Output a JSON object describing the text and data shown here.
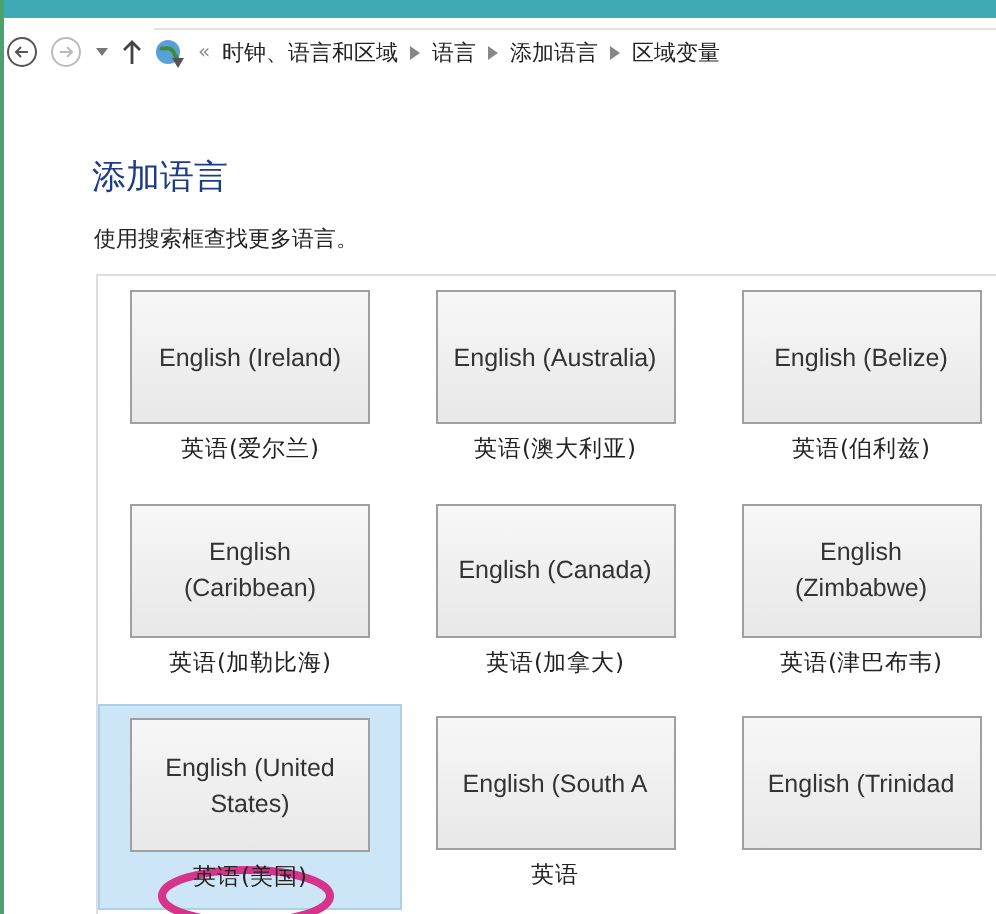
{
  "breadcrumb": {
    "overflow": "«",
    "items": [
      "时钟、语言和区域",
      "语言",
      "添加语言",
      "区域变量"
    ]
  },
  "heading": "添加语言",
  "hint": "使用搜索框查找更多语言。",
  "languages": [
    {
      "name": "English (Ireland)",
      "label": "英语(爱尔兰)",
      "selected": false,
      "circled": false
    },
    {
      "name": "English (Australia)",
      "label": "英语(澳大利亚)",
      "selected": false,
      "circled": false
    },
    {
      "name": "English (Belize)",
      "label": "英语(伯利兹)",
      "selected": false,
      "circled": false
    },
    {
      "name": "English (Caribbean)",
      "label": "英语(加勒比海)",
      "selected": false,
      "circled": false
    },
    {
      "name": "English (Canada)",
      "label": "英语(加拿大)",
      "selected": false,
      "circled": false
    },
    {
      "name": "English (Zimbabwe)",
      "label": "英语(津巴布韦)",
      "selected": false,
      "circled": false
    },
    {
      "name": "English (United States)",
      "label": "英语(美国)",
      "selected": true,
      "circled": true
    },
    {
      "name": "English (South A",
      "label": "英语",
      "selected": false,
      "circled": false
    },
    {
      "name": "English (Trinidad",
      "selected": false,
      "circled": false
    }
  ]
}
